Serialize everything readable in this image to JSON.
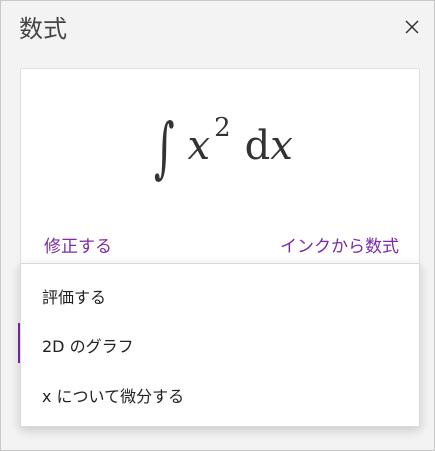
{
  "pane": {
    "title": "数式",
    "close_glyph": "close-icon"
  },
  "equation": {
    "integral_symbol": "∫",
    "variable": "x",
    "exponent": "2",
    "differential_d": "d",
    "differential_var": "x"
  },
  "links": {
    "fix": "修正する",
    "ink_to_math": "インクから数式"
  },
  "menu": {
    "items": [
      {
        "label": "評価する"
      },
      {
        "label": "2D のグラフ"
      },
      {
        "label": "x について微分する"
      }
    ]
  },
  "colors": {
    "accent": "#7b2aa8",
    "pane_background": "#f3f3f3",
    "card_background": "#ffffff",
    "text": "#222222"
  }
}
